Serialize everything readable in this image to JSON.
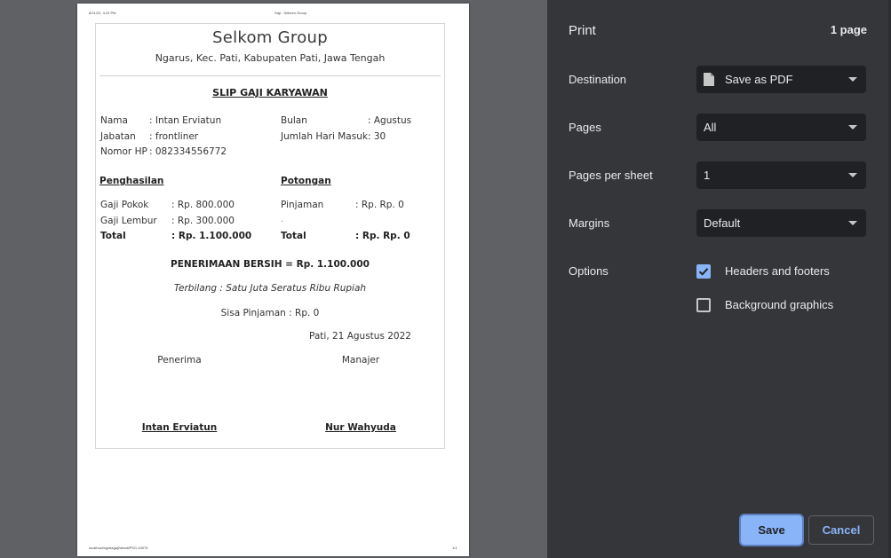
{
  "paper": {
    "header_left": "8/21/22, 4:23 PM",
    "header_center": "Gaji - Selkom Group",
    "footer_left": "localhost/ngaksgaji/detail/PSG-43075",
    "footer_right": "1/1"
  },
  "slip": {
    "company": "Selkom Group",
    "address": "Ngarus, Kec. Pati, Kabupaten Pati, Jawa Tengah",
    "title": "SLIP GAJI KARYAWAN",
    "info": {
      "nama_label": "Nama",
      "nama_value": ": Intan Erviatun",
      "jabatan_label": "Jabatan",
      "jabatan_value": ": frontliner",
      "hp_label": "Nomor HP",
      "hp_value": ": 082334556772",
      "bulan_label": "Bulan",
      "bulan_value": ": Agustus",
      "hari_label": "Jumlah Hari Masuk",
      "hari_value": ": 30"
    },
    "penghasilan": {
      "heading": "Penghasilan",
      "row1_label": "Gaji Pokok",
      "row1_value": ": Rp. 800.000",
      "row2_label": "Gaji Lembur",
      "row2_value": ": Rp. 300.000",
      "total_label": "Total",
      "total_value": ": Rp. 1.100.000"
    },
    "potongan": {
      "heading": "Potongan",
      "row1_label": "Pinjaman",
      "row1_value": ":  Rp. Rp. 0",
      "row2_label": ".",
      "total_label": "Total",
      "total_value": ":  Rp. Rp. 0"
    },
    "net_pay": "PENERIMAAN BERSIH = Rp. 1.100.000",
    "terbilang": "Terbilang : Satu Juta Seratus Ribu Rupiah",
    "sisa_pinjaman": "Sisa Pinjaman : Rp. 0",
    "date_place": "Pati, 21 Agustus 2022",
    "receiver_label": "Penerima",
    "manager_label": "Manajer",
    "receiver_name": "Intan Erviatun",
    "manager_name": "Nur Wahyuda"
  },
  "print_panel": {
    "title": "Print",
    "page_count": "1 page",
    "destination_label": "Destination",
    "destination_value": "Save as PDF",
    "destination_icon": "file-icon",
    "pages_label": "Pages",
    "pages_value": "All",
    "pages_per_sheet_label": "Pages per sheet",
    "pages_per_sheet_value": "1",
    "margins_label": "Margins",
    "margins_value": "Default",
    "options_label": "Options",
    "headers_footers_label": "Headers and footers",
    "headers_footers_checked": true,
    "background_graphics_label": "Background graphics",
    "background_graphics_checked": false,
    "save_label": "Save",
    "cancel_label": "Cancel",
    "accent_color": "#8ab4f8",
    "panel_color": "#35363a"
  }
}
